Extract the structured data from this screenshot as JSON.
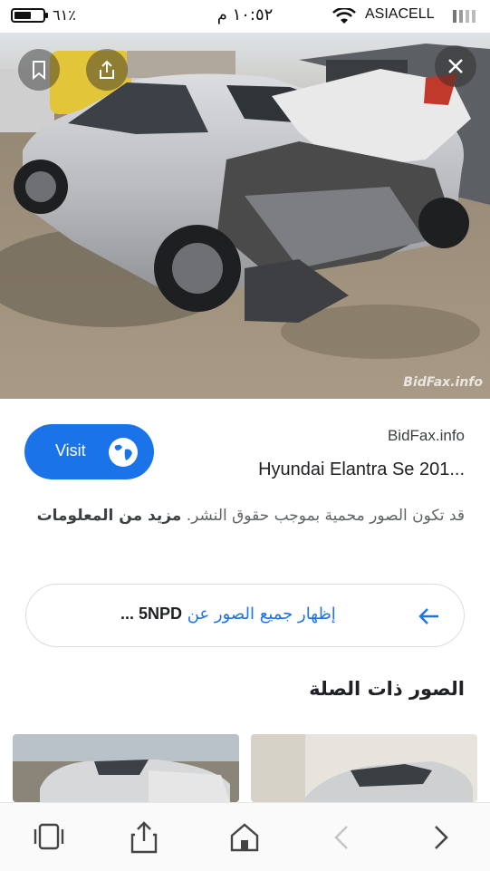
{
  "status_bar": {
    "battery_percent": "٦١٪",
    "battery_level": 0.61,
    "time": "١٠:٥٢ م",
    "carrier": "ASIACELL"
  },
  "image": {
    "watermark": "BidFax.info",
    "subject": "damaged silver Hyundai Elantra sedan, rear crash, salvage lot"
  },
  "result": {
    "visit_label": "Visit",
    "source": "BidFax.info",
    "title": "Hyundai Elantra Se 201...",
    "copyright_text": "قد تكون الصور محمية بموجب حقوق النشر.",
    "more_info": "مزيد من المعلومات"
  },
  "show_all": {
    "text": "إظهار جميع الصور عن",
    "query": "5NPD ..."
  },
  "related": {
    "heading": "الصور ذات الصلة"
  },
  "icons": {
    "bookmark": "bookmark-icon",
    "share": "share-icon",
    "close": "close-icon",
    "globe": "globe-icon",
    "arrow": "arrow-left-icon",
    "tabs": "tabs-icon",
    "home": "home-icon",
    "back": "chevron-left-icon",
    "forward": "chevron-right-icon"
  },
  "colors": {
    "accent": "#1a73e8",
    "text": "#202124",
    "muted": "#5f6368"
  }
}
